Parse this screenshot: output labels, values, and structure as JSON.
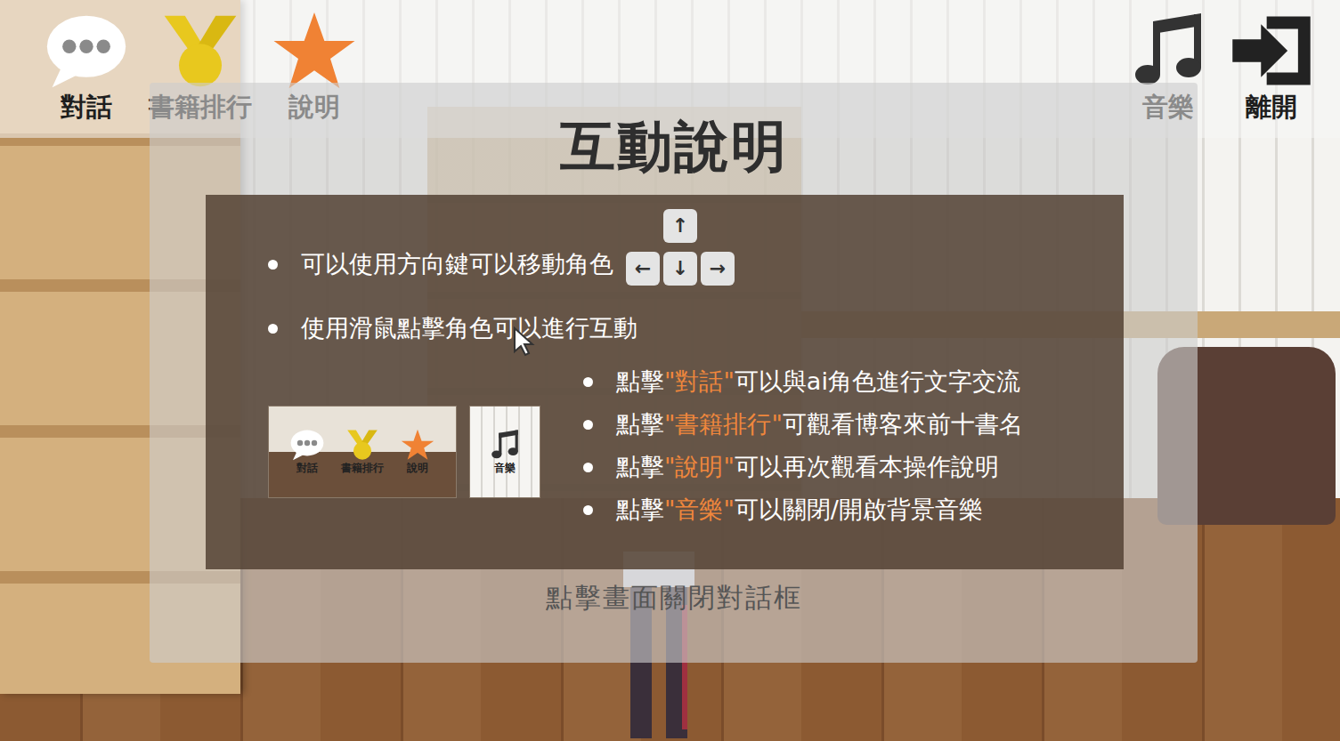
{
  "toolbar": {
    "left": [
      "對話",
      "書籍排行",
      "說明"
    ],
    "right": [
      "音樂",
      "離開"
    ]
  },
  "dialog": {
    "title": "互動說明",
    "bullets": [
      "可以使用方向鍵可以移動角色",
      "使用滑鼠點擊角色可以進行互動"
    ],
    "keys": [
      "↑",
      "←",
      "↓",
      "→"
    ],
    "thumbnail": {
      "items": [
        "對話",
        "書籍排行",
        "說明"
      ],
      "music": "音樂"
    },
    "tips": [
      {
        "prefix": "點擊",
        "highlight": "\"對話\"",
        "suffix": "可以與ai角色進行文字交流"
      },
      {
        "prefix": "點擊",
        "highlight": "\"書籍排行\"",
        "suffix": "可觀看博客來前十書名"
      },
      {
        "prefix": "點擊",
        "highlight": "\"說明\"",
        "suffix": "可以再次觀看本操作說明"
      },
      {
        "prefix": "點擊",
        "highlight": "\"音樂\"",
        "suffix": "可以關閉/開啟背景音樂"
      }
    ],
    "footer": "點擊畫面關閉對話框"
  }
}
